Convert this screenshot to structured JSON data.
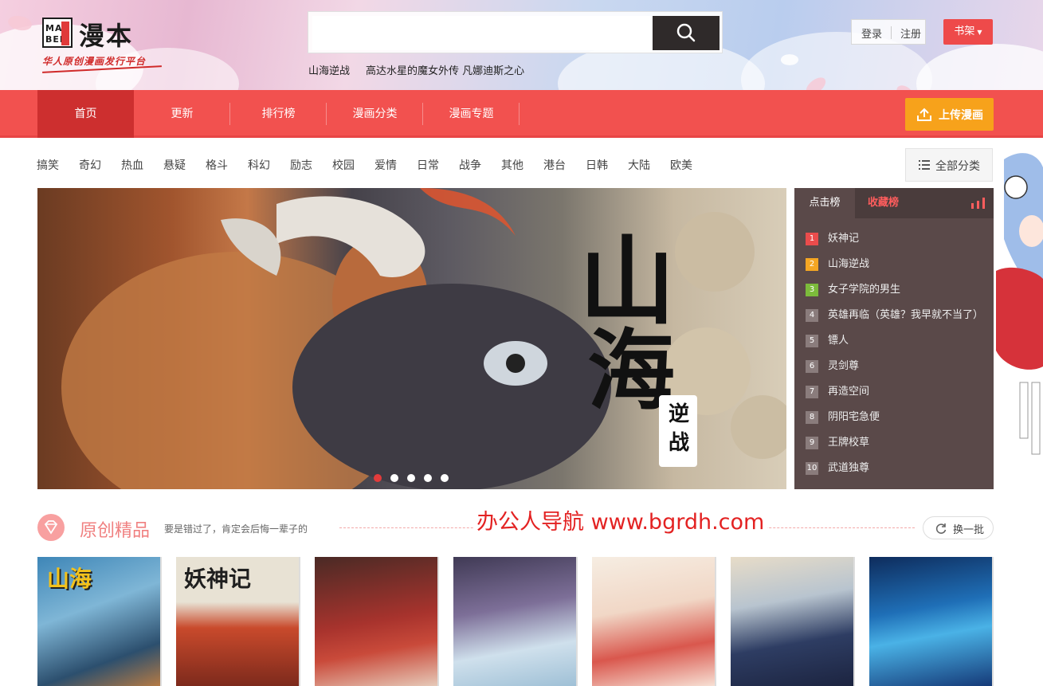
{
  "header": {
    "logo_box_top": "MAN",
    "logo_box_bottom": "BEN",
    "logo_text": "漫本",
    "slogan": "华人原创漫画发行平台",
    "search_placeholder": "",
    "hot_words": [
      "山海逆战",
      "高达水星的魔女外传 凡娜迪斯之心"
    ],
    "login_label": "登录",
    "register_label": "注册",
    "shelf_label": "书架"
  },
  "nav": {
    "items": [
      "首页",
      "更新",
      "排行榜",
      "漫画分类",
      "漫画专题"
    ],
    "active_index": 0,
    "upload_label": "上传漫画"
  },
  "categories": {
    "items": [
      "搞笑",
      "奇幻",
      "热血",
      "悬疑",
      "格斗",
      "科幻",
      "励志",
      "校园",
      "爱情",
      "日常",
      "战争",
      "其他",
      "港台",
      "日韩",
      "大陆",
      "欧美"
    ],
    "all_label": "全部分类"
  },
  "banner": {
    "title_chars": [
      "山",
      "海"
    ],
    "subtitle": "逆战",
    "slide_count": 5,
    "active_slide": 0
  },
  "ranking": {
    "tab_active": "点击榜",
    "tab_inactive": "收藏榜",
    "items": [
      {
        "num": "1",
        "title": "妖神记"
      },
      {
        "num": "2",
        "title": "山海逆战"
      },
      {
        "num": "3",
        "title": "女子学院的男生"
      },
      {
        "num": "4",
        "title": "英雄再临（英雄？我早就不当了）"
      },
      {
        "num": "5",
        "title": "镖人"
      },
      {
        "num": "6",
        "title": "灵剑尊"
      },
      {
        "num": "7",
        "title": "再造空间"
      },
      {
        "num": "8",
        "title": "阴阳宅急便"
      },
      {
        "num": "9",
        "title": "王牌校草"
      },
      {
        "num": "10",
        "title": "武道独尊"
      }
    ]
  },
  "section": {
    "title": "原创精品",
    "subtitle": "要是错过了，肯定会后悔一辈子的",
    "refresh_label": "换一批",
    "watermark": "办公人导航 www.bgrdh.com"
  },
  "comics": {
    "cover_titles": [
      "山海",
      "妖神记",
      "",
      "",
      "",
      "",
      ""
    ]
  },
  "colors": {
    "nav_red": "#f2514f",
    "nav_active": "#cd2f2f",
    "upload_orange": "#f7a21b",
    "rank_bg": "#5a4949"
  }
}
